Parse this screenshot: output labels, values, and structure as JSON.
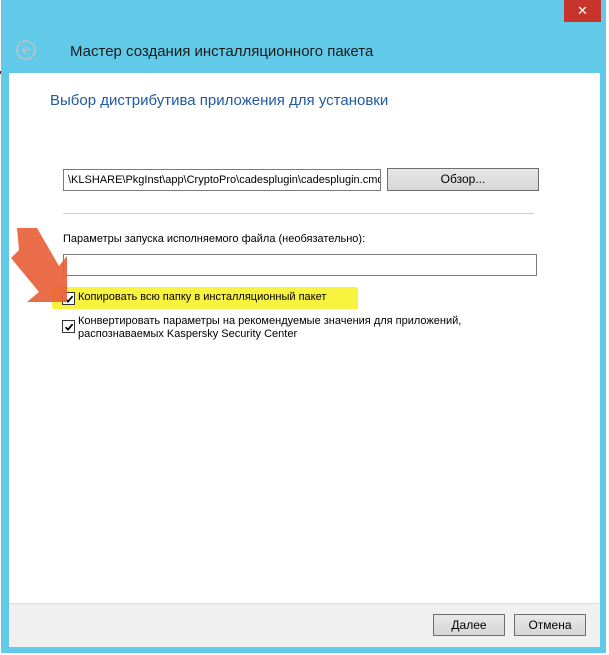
{
  "window": {
    "title": "Мастер создания инсталляционного пакета",
    "close_glyph": "✕"
  },
  "page": {
    "heading": "Выбор дистрибутива приложения для установки"
  },
  "distribution": {
    "path_value": "\\KLSHARE\\PkgInst\\app\\CryptoPro\\cadesplugin\\cadesplugin.cmd",
    "browse_label": "Обзор..."
  },
  "params": {
    "label": "Параметры запуска исполняемого файла (необязательно):",
    "value": ""
  },
  "options": [
    {
      "label": "Копировать всю папку в инсталляционный пакет",
      "checked": true
    },
    {
      "label": "Конвертировать параметры на рекомендуемые значения для приложений, распознаваемых Kaspersky Security Center",
      "checked": true
    }
  ],
  "buttons": {
    "next_label": "Далее",
    "cancel_label": "Отмена"
  },
  "colors": {
    "titlebar": "#61cae8",
    "close": "#c7342b",
    "heading": "#1f5a9f",
    "highlight": "#f8f33f",
    "arrow": "#e8613a"
  },
  "icons": {
    "back": "back-arrow-icon",
    "close": "close-icon",
    "check": "checkmark-icon",
    "pointer": "arrow-pointer-icon"
  }
}
